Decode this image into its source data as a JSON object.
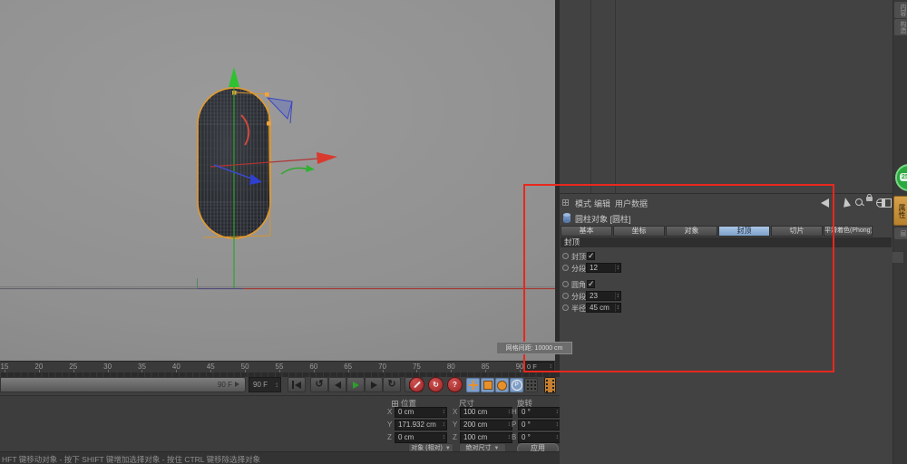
{
  "viewport": {
    "grid_tooltip": "网格间距: 10000 cm"
  },
  "timeline": {
    "ruler_labels": [
      "15",
      "20",
      "25",
      "30",
      "35",
      "40",
      "45",
      "50",
      "55",
      "60",
      "65",
      "70",
      "75",
      "80",
      "85",
      "90"
    ],
    "end_frame_field": "0 F",
    "slider_value": "90 F",
    "frame_field": "90 F"
  },
  "coordinates": {
    "headers": [
      "位置",
      "尺寸",
      "旋转"
    ],
    "rows": [
      {
        "labels": [
          "X",
          "X",
          "H"
        ],
        "values": [
          "0 cm",
          "100 cm",
          "0 °"
        ]
      },
      {
        "labels": [
          "Y",
          "Y",
          "P"
        ],
        "values": [
          "171.932 cm",
          "200 cm",
          "0 °"
        ]
      },
      {
        "labels": [
          "Z",
          "Z",
          "B"
        ],
        "values": [
          "0 cm",
          "100 cm",
          "0 °"
        ]
      }
    ],
    "mode_dropdown": "对象 (相对)",
    "size_dropdown": "绝对尺寸",
    "apply_button": "应用"
  },
  "attributes": {
    "menu": [
      "模式",
      "编辑",
      "用户数据"
    ],
    "object_title": "圆柱对象 [圆柱]",
    "tabs": [
      "基本",
      "坐标",
      "对象",
      "封顶",
      "切片",
      "平滑着色(Phong)"
    ],
    "active_tab": "封顶",
    "section": "封顶",
    "fields": [
      {
        "label": "封顶",
        "type": "check",
        "checked": true
      },
      {
        "label": "分段",
        "type": "number",
        "value": "12"
      },
      {
        "label": "圆角",
        "type": "check",
        "checked": true
      },
      {
        "label": "分段",
        "type": "number",
        "value": "23"
      },
      {
        "label": "半径",
        "type": "number",
        "value": "45 cm"
      }
    ]
  },
  "side_strip": {
    "top_tabs": [
      "内容",
      "构造"
    ],
    "active_tab": "属性",
    "sub_tab": "层",
    "green_badge": "25"
  },
  "status": {
    "text": "HFT 键移动对象 - 按下 SHIFT 键增加选择对象 - 按住 CTRL 键移除选择对象"
  },
  "colors": {
    "annotation_red": "#e8281e",
    "selection_orange": "#e09a35",
    "axis_green": "#2da32d",
    "axis_red": "#d93a2e",
    "axis_blue": "#3b49c9",
    "active_tab_blue": "#8cb0dc",
    "badge_green": "#2ba83e"
  }
}
